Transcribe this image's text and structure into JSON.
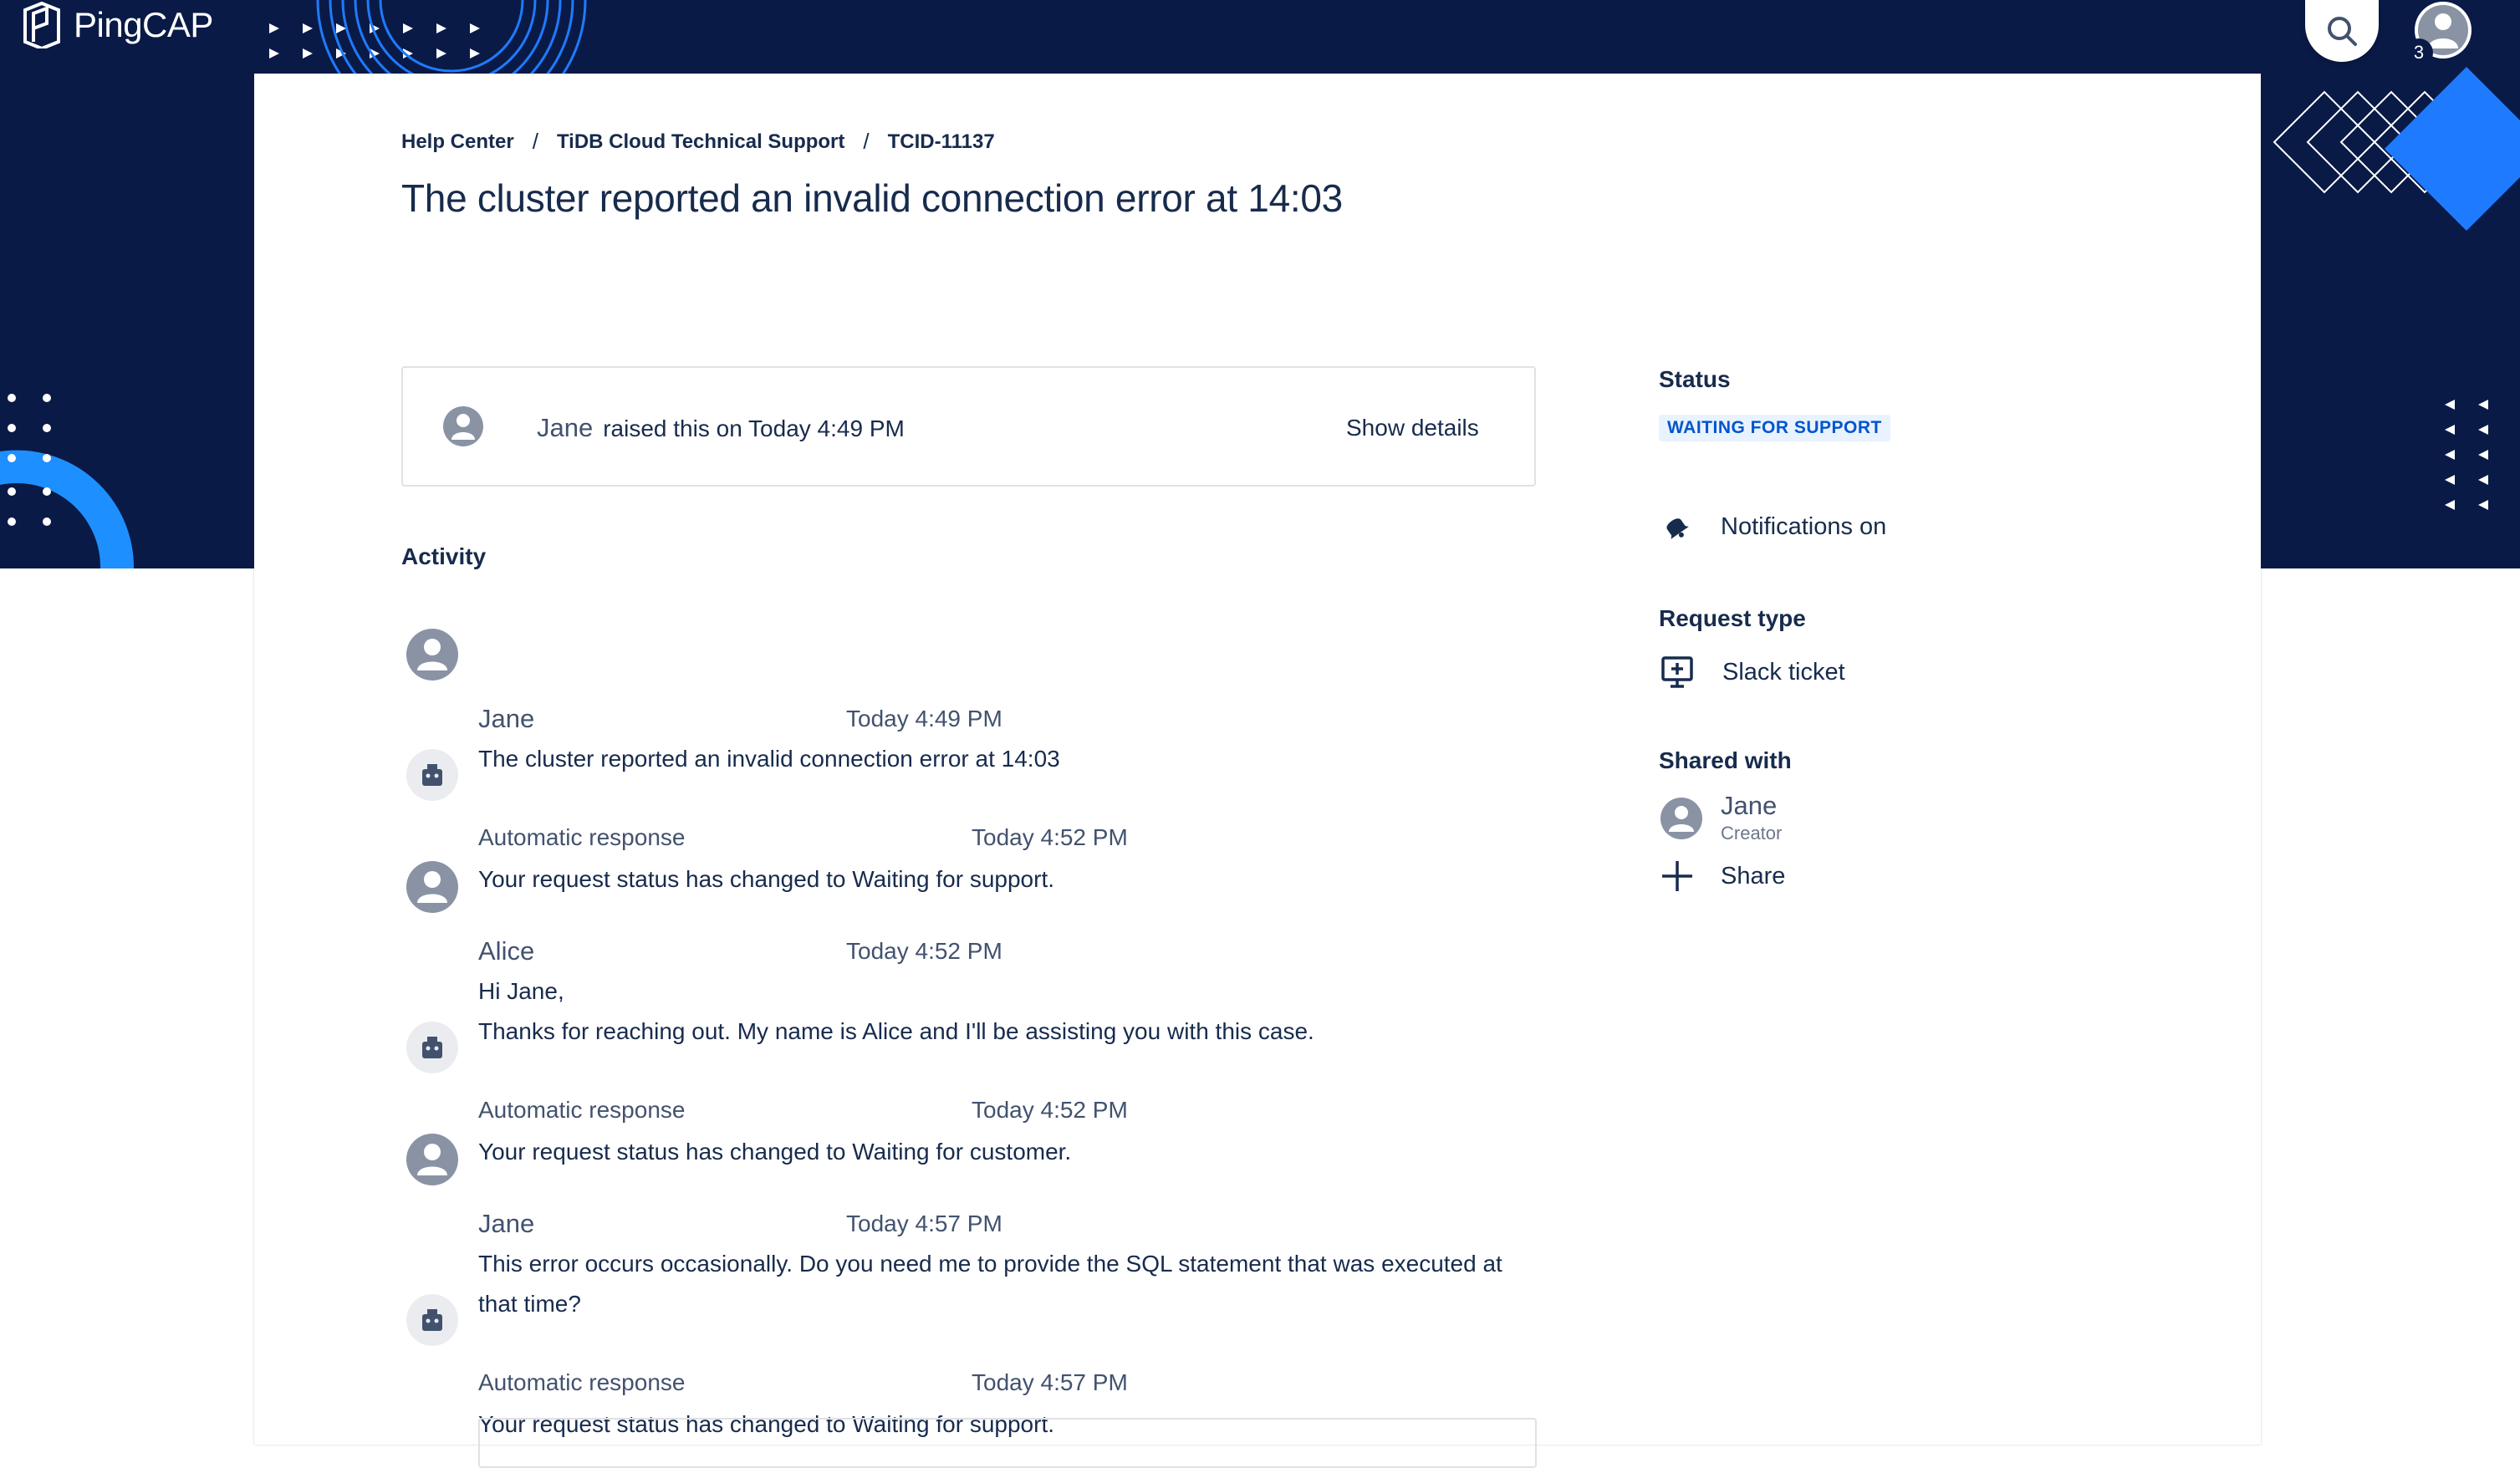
{
  "brand": {
    "name": "PingCAP"
  },
  "header": {
    "notification_count": "3"
  },
  "breadcrumb": [
    "Help Center",
    "TiDB Cloud Technical Support",
    "TCID-11137"
  ],
  "breadcrumb_separator": "/",
  "title": "The cluster reported an invalid connection error at 14:03",
  "raised": {
    "name": "Jane",
    "text": "raised this on Today 4:49 PM",
    "show_details": "Show details"
  },
  "activity": {
    "heading": "Activity",
    "items": [
      {
        "author": "Jane",
        "time": "Today 4:49 PM",
        "lines": [
          "The cluster reported an invalid connection error at 14:03"
        ]
      },
      {
        "author": "Automatic response",
        "time": "Today 4:52 PM",
        "lines": [
          "Your request status has changed to Waiting for support."
        ]
      },
      {
        "author": "Alice",
        "time": "Today 4:52 PM",
        "lines": [
          "Hi Jane,",
          "Thanks for reaching out. My name is Alice and I'll be assisting you with this case."
        ]
      },
      {
        "author": "Automatic response",
        "time": "Today 4:52 PM",
        "lines": [
          "Your request status has changed to Waiting for customer."
        ]
      },
      {
        "author": "Jane",
        "time": "Today 4:57 PM",
        "lines": [
          "This error occurs occasionally. Do you need me to provide the SQL statement that was executed at",
          "that time?"
        ]
      },
      {
        "author": "Automatic response",
        "time": "Today 4:57 PM",
        "lines": [
          "Your request status has changed to Waiting for support."
        ]
      }
    ]
  },
  "sidebar": {
    "status_label": "Status",
    "status_value": "WAITING FOR SUPPORT",
    "notifications": "Notifications on",
    "request_type_label": "Request type",
    "request_type_value": "Slack ticket",
    "shared_with_label": "Shared with",
    "shared_user": {
      "name": "Jane",
      "role": "Creator"
    },
    "share_label": "Share"
  },
  "colors": {
    "header_bg": "#0a1a47",
    "accent_blue": "#1e7bff",
    "badge_bg": "#e9f2ff",
    "badge_text": "#0055cc",
    "text_primary": "#172b4d",
    "text_secondary": "#42526e"
  }
}
